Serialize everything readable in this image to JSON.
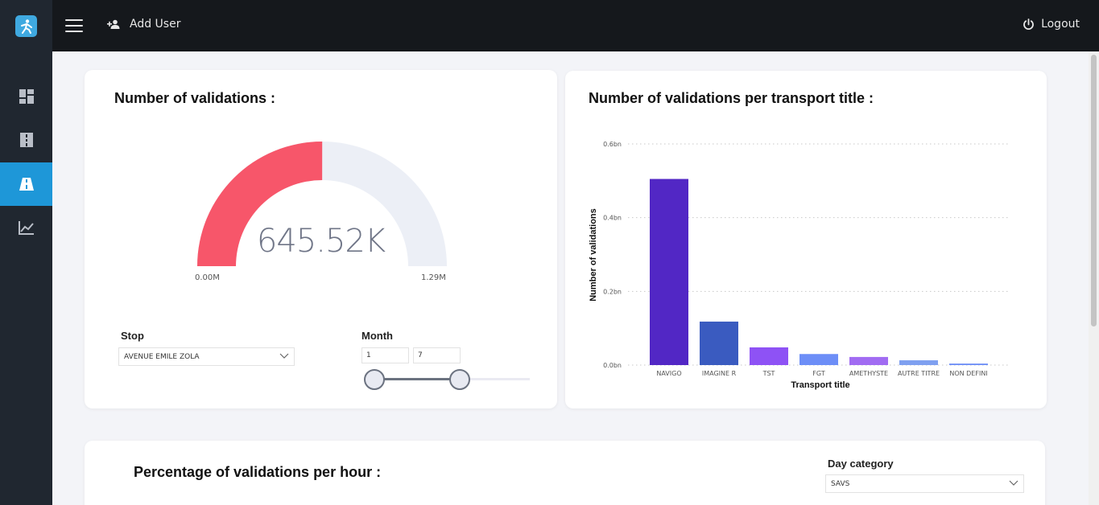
{
  "topbar": {
    "add_user_label": "Add User",
    "logout_label": "Logout"
  },
  "sidebar": {
    "items": [
      "dashboard-icon",
      "road-icon",
      "highway-icon",
      "chart-icon"
    ],
    "active_index": 2
  },
  "validations_card": {
    "title": "Number of validations :",
    "gauge": {
      "value_label": "645.52K",
      "min_label": "0.00M",
      "max_label": "1.29M",
      "value": 645520,
      "max": 1290000,
      "fill_color": "#f7566a",
      "track_color": "#eceff6"
    },
    "stop": {
      "label": "Stop",
      "value": "AVENUE EMILE ZOLA"
    },
    "month": {
      "label": "Month",
      "from": "1",
      "to": "7"
    }
  },
  "transport_card": {
    "title": "Number of validations per transport title :"
  },
  "chart_data": {
    "type": "bar",
    "categories": [
      "NAVIGO",
      "IMAGINE R",
      "TST",
      "FGT",
      "AMETHYSTE",
      "AUTRE TITRE",
      "NON DEFINI"
    ],
    "values": [
      0.505,
      0.118,
      0.048,
      0.03,
      0.022,
      0.013,
      0.004
    ],
    "colors": [
      "#5227c5",
      "#3a5bc0",
      "#8e52f5",
      "#6d8ef7",
      "#a16cf2",
      "#7fa0f0",
      "#6d8ef7"
    ],
    "xlabel": "Transport title",
    "ylabel": "Number of validations",
    "ylim": [
      0,
      0.6
    ],
    "yticks": [
      "0.0bn",
      "0.2bn",
      "0.4bn",
      "0.6bn"
    ],
    "ytick_values": [
      0,
      0.2,
      0.4,
      0.6
    ],
    "grid": true
  },
  "hourly_card": {
    "title": "Percentage of validations per hour :",
    "day_category": {
      "label": "Day category",
      "value": "SAVS"
    }
  }
}
